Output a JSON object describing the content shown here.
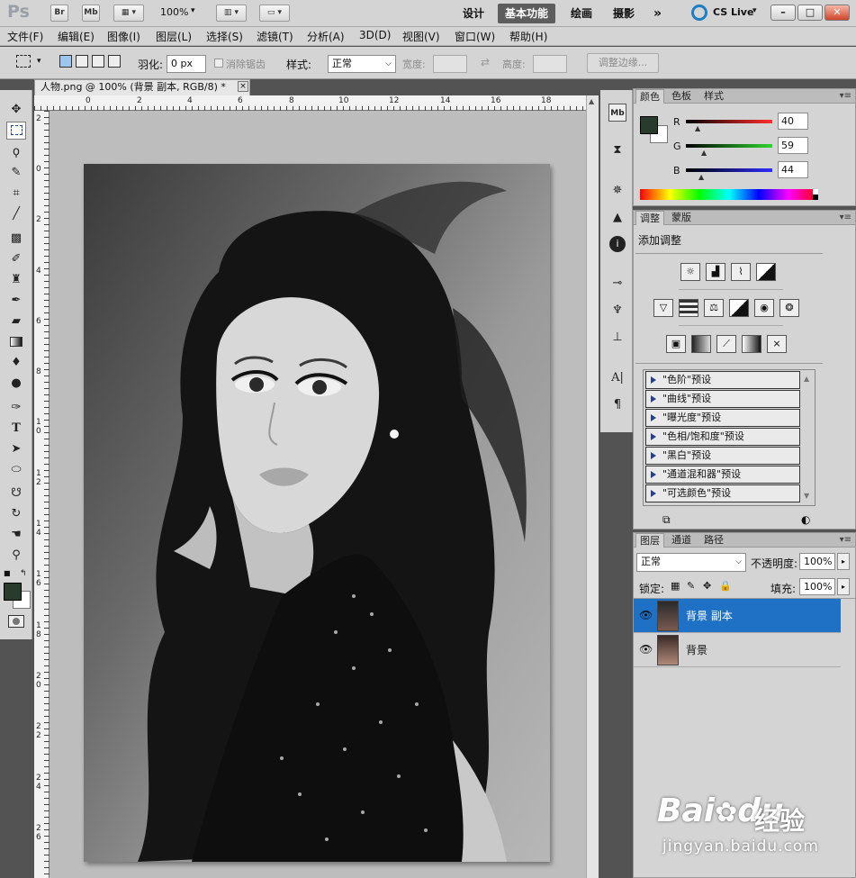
{
  "app": {
    "logo": "Ps",
    "bridge": "Br",
    "minibridge": "Mb",
    "zoom": "100%",
    "workspaces": [
      "设计",
      "基本功能",
      "绘画",
      "摄影"
    ],
    "more": "»",
    "cslive": "CS Live",
    "window_controls": [
      "–",
      "□",
      "✕"
    ]
  },
  "menu": [
    "文件(F)",
    "编辑(E)",
    "图像(I)",
    "图层(L)",
    "选择(S)",
    "滤镜(T)",
    "分析(A)",
    "3D(D)",
    "视图(V)",
    "窗口(W)",
    "帮助(H)"
  ],
  "options": {
    "feather_label": "羽化:",
    "feather_value": "0 px",
    "antialias_label": "消除锯齿",
    "style_label": "样式:",
    "style_value": "正常",
    "width_label": "宽度:",
    "height_label": "高度:",
    "refine_button": "调整边缘..."
  },
  "document": {
    "tab_title": "人物.png @ 100% (背景 副本, RGB/8) *",
    "close": "×",
    "hruler": [
      "0",
      "2",
      "4",
      "6",
      "8",
      "10",
      "12",
      "14",
      "16",
      "18"
    ],
    "vruler": [
      "2",
      "0",
      "2",
      "4",
      "6",
      "8",
      "1 0",
      "1 2",
      "1 4",
      "1 6",
      "1 8",
      "2 0",
      "2 2",
      "2 4",
      "2 6"
    ]
  },
  "color_panel": {
    "tabs": [
      "颜色",
      "色板",
      "样式"
    ],
    "r_label": "R",
    "r_value": "40",
    "g_label": "G",
    "g_value": "59",
    "b_label": "B",
    "b_value": "44",
    "foreground": "#283b2c"
  },
  "adjust_panel": {
    "tabs": [
      "调整",
      "蒙版"
    ],
    "heading": "添加调整",
    "presets": [
      "\"色阶\"预设",
      "\"曲线\"预设",
      "\"曝光度\"预设",
      "\"色相/饱和度\"预设",
      "\"黑白\"预设",
      "\"通道混和器\"预设",
      "\"可选颜色\"预设"
    ]
  },
  "layers_panel": {
    "tabs": [
      "图层",
      "通道",
      "路径"
    ],
    "blend_mode": "正常",
    "opacity_label": "不透明度:",
    "opacity_value": "100%",
    "lock_label": "锁定:",
    "fill_label": "填充:",
    "fill_value": "100%",
    "layers": [
      {
        "name": "背景 副本",
        "selected": true
      },
      {
        "name": "背景",
        "selected": false
      }
    ]
  },
  "watermark": {
    "brand": "Bai",
    "brand2": "du",
    "product": "经验",
    "url": "jingyan.baidu.com"
  }
}
